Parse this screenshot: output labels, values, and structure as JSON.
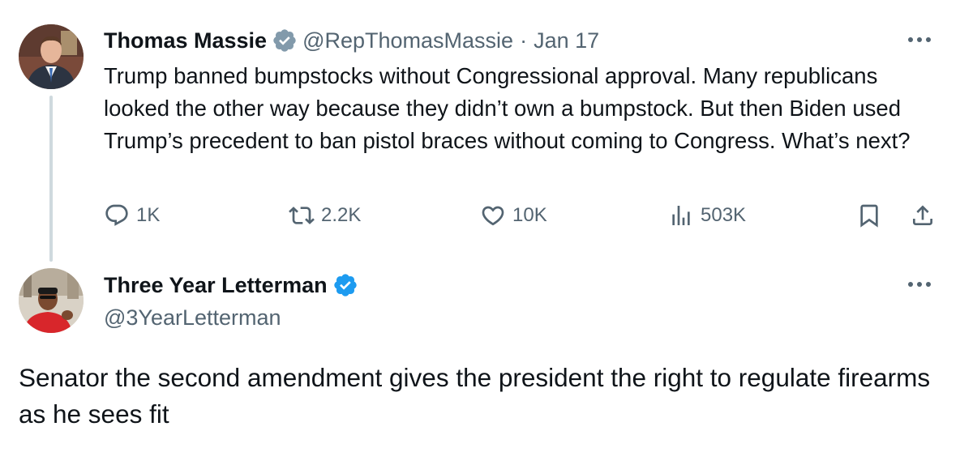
{
  "colors": {
    "text_primary": "#0f1419",
    "text_secondary": "#536471",
    "verified_gray": "#829aab",
    "verified_blue": "#1d9bf0",
    "thread_line": "#cfd9de"
  },
  "tweet1": {
    "author_name": "Thomas Massie",
    "badge": "verified-gray-icon",
    "handle": "@RepThomasMassie",
    "separator": "·",
    "date": "Jan 17",
    "text": "Trump banned bumpstocks without Congressional approval. Many republicans looked the other way because they didn’t own a bumpstock. But then Biden used Trump’s precedent to ban pistol braces without coming to Congress. What’s next?",
    "actions": {
      "replies": "1K",
      "reposts": "2.2K",
      "likes": "10K",
      "views": "503K"
    }
  },
  "tweet2": {
    "author_name": "Three Year Letterman",
    "badge": "verified-blue-icon",
    "handle": "@3YearLetterman",
    "text": "Senator the second amendment gives the president the right to regulate firearms as he sees fit"
  }
}
